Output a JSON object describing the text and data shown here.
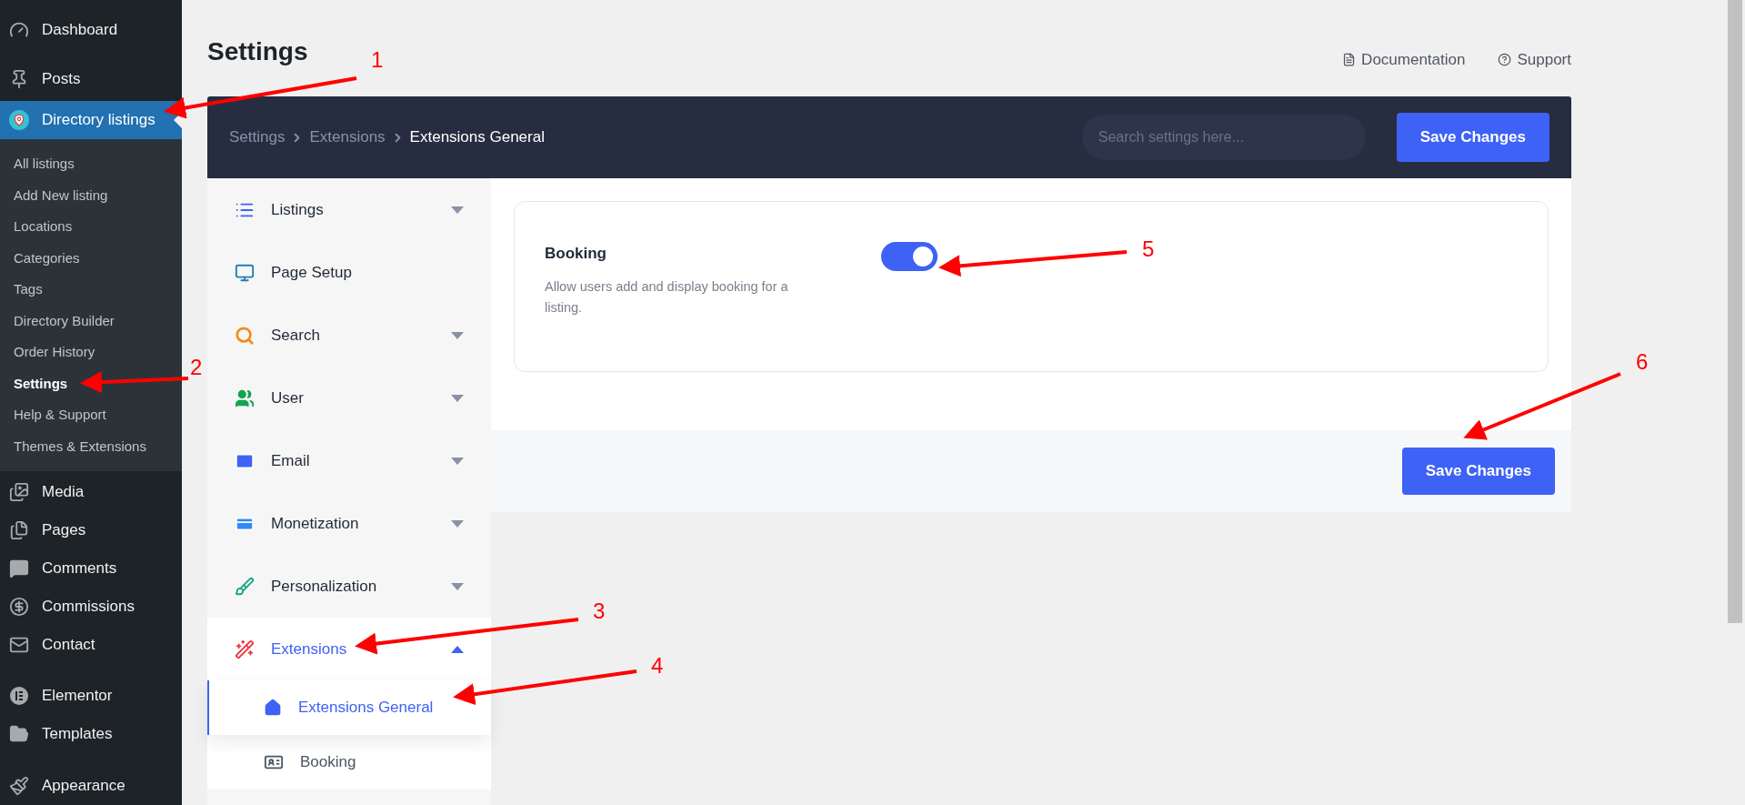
{
  "admin_menu": {
    "top": [
      {
        "label": "Dashboard",
        "selected": false
      },
      {
        "label": "Posts",
        "selected": false
      },
      {
        "label": "Directory listings",
        "selected": true
      }
    ],
    "submenu": [
      {
        "label": "All listings",
        "selected": false
      },
      {
        "label": "Add New listing",
        "selected": false
      },
      {
        "label": "Locations",
        "selected": false
      },
      {
        "label": "Categories",
        "selected": false
      },
      {
        "label": "Tags",
        "selected": false
      },
      {
        "label": "Directory Builder",
        "selected": false
      },
      {
        "label": "Order History",
        "selected": false
      },
      {
        "label": "Settings",
        "selected": true
      },
      {
        "label": "Help & Support",
        "selected": false
      },
      {
        "label": "Themes & Extensions",
        "selected": false
      }
    ],
    "bottom": [
      {
        "label": "Media",
        "selected": false
      },
      {
        "label": "Pages",
        "selected": false
      },
      {
        "label": "Comments",
        "selected": false
      },
      {
        "label": "Commissions",
        "selected": false
      },
      {
        "label": "Contact",
        "selected": false
      },
      {
        "label": "Elementor",
        "selected": false
      },
      {
        "label": "Templates",
        "selected": false
      },
      {
        "label": "Appearance",
        "selected": false
      }
    ]
  },
  "page_title": "Settings",
  "header_links": [
    "Documentation",
    "Support"
  ],
  "breadcrumbs": [
    "Settings",
    "Extensions",
    "Extensions General"
  ],
  "search": {
    "placeholder": "Search settings here..."
  },
  "save_button": "Save Changes",
  "nav": [
    {
      "label": "Listings",
      "selected": false,
      "expanded": false
    },
    {
      "label": "Page Setup",
      "selected": false
    },
    {
      "label": "Search",
      "selected": false,
      "expanded": false
    },
    {
      "label": "User",
      "selected": false,
      "expanded": false
    },
    {
      "label": "Email",
      "selected": false,
      "expanded": false
    },
    {
      "label": "Monetization",
      "selected": false,
      "expanded": false
    },
    {
      "label": "Personalization",
      "selected": false,
      "expanded": false
    },
    {
      "label": "Extensions",
      "selected": true,
      "expanded": true,
      "children": [
        {
          "label": "Extensions General",
          "selected": true
        },
        {
          "label": "Booking",
          "selected": false
        }
      ]
    }
  ],
  "setting": {
    "title": "Booking",
    "description": "Allow users add and display booking for a listing.",
    "on": true
  },
  "footer_save_button": "Save Changes",
  "annotations": [
    "1",
    "2",
    "3",
    "4",
    "5",
    "6"
  ]
}
